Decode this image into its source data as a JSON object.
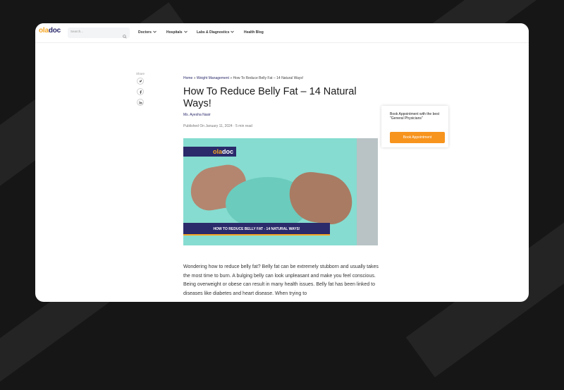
{
  "brand": {
    "logo_part1": "ola",
    "logo_part2": "doc",
    "accent": "#f5a623",
    "primary": "#2b2a6b",
    "cta": "#f7941d"
  },
  "search": {
    "placeholder": "Search..."
  },
  "nav": {
    "doctors": "Doctors",
    "hospitals": "Hospitals",
    "labs": "Labs & Diagnostics",
    "blog": "Health Blog"
  },
  "share": {
    "label": "Share",
    "icons": [
      "twitter-icon",
      "facebook-icon",
      "linkedin-icon"
    ]
  },
  "breadcrumb": {
    "home": "Home",
    "sep1": " » ",
    "category": "Weight Management",
    "sep2": " » ",
    "current": "How To Reduce Belly Fat – 14 Natural Ways!"
  },
  "article": {
    "title": "How To Reduce Belly Fat – 14 Natural Ways!",
    "author": "Ms. Ayesha Nasir",
    "published": "Published On January 11, 2024",
    "meta_sep": " · ",
    "read_time": "5 min read",
    "hero_logo_1": "ola",
    "hero_logo_2": "doc",
    "hero_banner": "HOW TO REDUCE BELLY FAT - 14 NATURAL WAYS!",
    "intro": "Wondering how to reduce belly fat? Belly fat can be extremely stubborn and usually takes the most time to burn. A bulging belly can look unpleasant and make you feel conscious. Being overweight or obese can result in many health issues. Belly fat has been linked to diseases like diabetes and heart disease. When trying to"
  },
  "appointment": {
    "text": "Book Appointment with the best \"General Physicians\"",
    "button": "Book Appointment"
  }
}
